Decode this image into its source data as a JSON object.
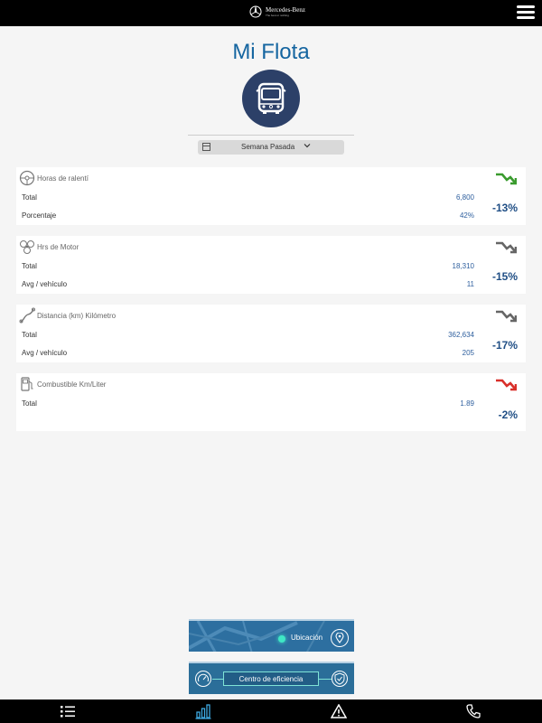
{
  "header": {
    "brand_name": "Mercedes-Benz",
    "brand_sub": "The best or nothing",
    "menu_icon": "hamburger-icon"
  },
  "page": {
    "title": "Mi Flota",
    "vehicle_icon": "bus-icon"
  },
  "period_selector": {
    "label": "Semana Pasada",
    "icon": "calendar-icon"
  },
  "metrics": [
    {
      "title": "Horas de ralentí",
      "icon": "steering-wheel-icon",
      "rows": [
        {
          "label": "Total",
          "value": "6,800"
        },
        {
          "label": "Porcentaje",
          "value": "42%"
        }
      ],
      "change": "-13%",
      "trend_color": "#3a9b2e"
    },
    {
      "title": "Hrs de Motor",
      "icon": "engine-icon",
      "rows": [
        {
          "label": "Total",
          "value": "18,310"
        },
        {
          "label": "Avg / vehículo",
          "value": "11"
        }
      ],
      "change": "-15%",
      "trend_color": "#666666"
    },
    {
      "title": "Distancia (km) Kilómetro",
      "icon": "road-icon",
      "rows": [
        {
          "label": "Total",
          "value": "362,634"
        },
        {
          "label": "Avg / vehículo",
          "value": "205"
        }
      ],
      "change": "-17%",
      "trend_color": "#666666"
    },
    {
      "title": "Combustible Km/Liter",
      "icon": "fuel-pump-icon",
      "rows": [
        {
          "label": "Total",
          "value": "1.89"
        }
      ],
      "change": "-2%",
      "trend_color": "#d9302a"
    }
  ],
  "shortcuts": {
    "location_label": "Ubicación",
    "efficiency_label": "Centro de eficiencia"
  },
  "bottom_nav": [
    "list-icon",
    "bar-chart-icon",
    "warning-icon",
    "phone-icon"
  ],
  "colors": {
    "accent": "#1565a0",
    "active_tab": "#3da8e0"
  }
}
